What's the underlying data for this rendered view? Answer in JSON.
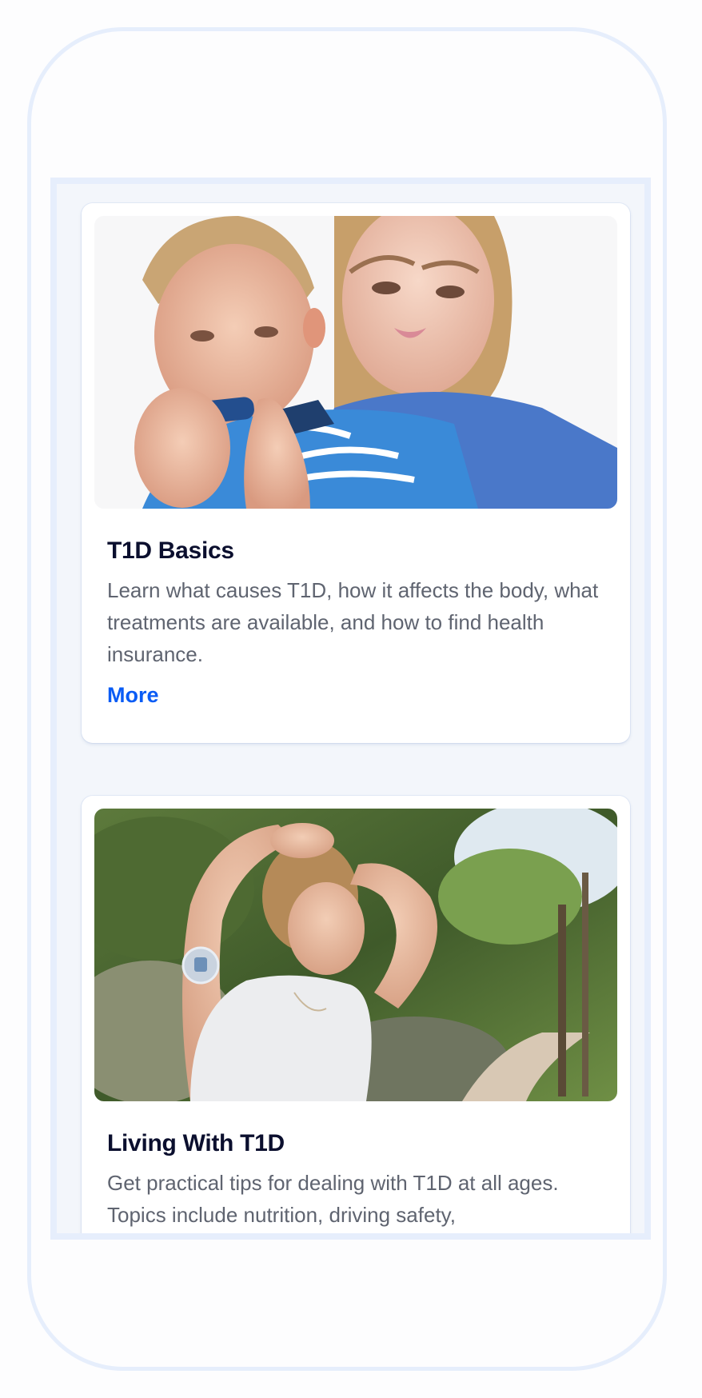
{
  "cards": [
    {
      "title": "T1D Basics",
      "description": "Learn what causes T1D, how it affects the body, what treatments are available, and how to find health insurance.",
      "link_label": "More",
      "image_subject": "child-with-insulin-pen-photo"
    },
    {
      "title": "Living With T1D",
      "description": "Get practical tips for dealing with T1D at all ages. Topics include nutrition, driving safety,",
      "image_subject": "woman-with-glucose-sensor-photo"
    }
  ],
  "colors": {
    "accent": "#0a5cf5",
    "title": "#0b0f2e",
    "body_text": "#5f6470",
    "frame": "#e6eefc",
    "panel_bg": "#f3f6fb"
  }
}
